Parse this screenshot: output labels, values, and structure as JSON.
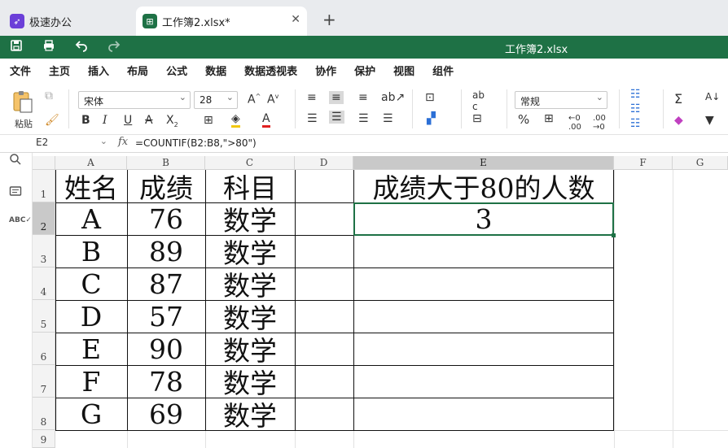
{
  "tabs": [
    {
      "label": "极速办公"
    },
    {
      "label": "工作簿2.xlsx*"
    }
  ],
  "title": "工作簿2.xlsx",
  "menu": [
    "文件",
    "主页",
    "插入",
    "布局",
    "公式",
    "数据",
    "数据透视表",
    "协作",
    "保护",
    "视图",
    "组件"
  ],
  "ribbon": {
    "paste_label": "粘贴",
    "font_name": "宋体",
    "font_size": "28",
    "number_format": "常规"
  },
  "namebox": "E2",
  "formula": "=COUNTIF(B2:B8,\">80\")",
  "columns": [
    "A",
    "B",
    "C",
    "D",
    "E",
    "F",
    "G"
  ],
  "rows": [
    "1",
    "2",
    "3",
    "4",
    "5",
    "6",
    "7",
    "8",
    "9"
  ],
  "sheet": {
    "headers": [
      "姓名",
      "成绩",
      "科目",
      "成绩大于80的人数"
    ],
    "records": [
      [
        "A",
        "76",
        "数学"
      ],
      [
        "B",
        "89",
        "数学"
      ],
      [
        "C",
        "87",
        "数学"
      ],
      [
        "D",
        "57",
        "数学"
      ],
      [
        "E",
        "90",
        "数学"
      ],
      [
        "F",
        "78",
        "数学"
      ],
      [
        "G",
        "69",
        "数学"
      ]
    ],
    "result": "3"
  },
  "colors": {
    "accent": "#1e7145",
    "app_icon": "#6b3fd8",
    "file_icon": "#1e7145"
  }
}
